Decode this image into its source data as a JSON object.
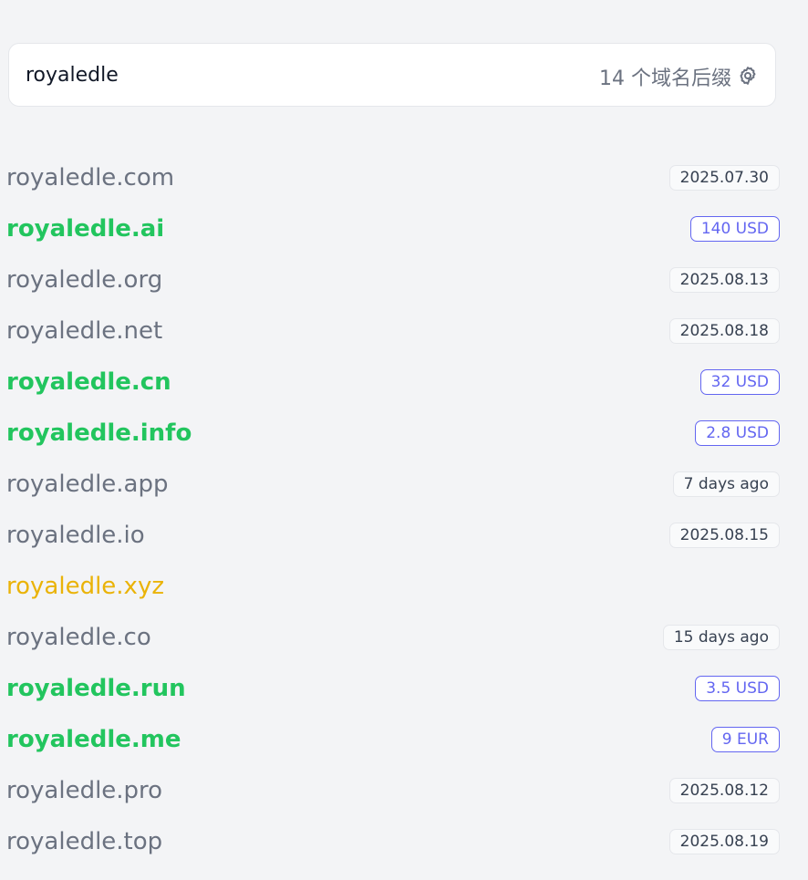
{
  "search": {
    "value": "royaledle",
    "suffix_count": "14 个域名后缀"
  },
  "domains": [
    {
      "name": "royaledle.com",
      "status": "taken",
      "badge": "2025.07.30",
      "badge_type": "date"
    },
    {
      "name": "royaledle.ai",
      "status": "available",
      "badge": "140 USD",
      "badge_type": "price"
    },
    {
      "name": "royaledle.org",
      "status": "taken",
      "badge": "2025.08.13",
      "badge_type": "date"
    },
    {
      "name": "royaledle.net",
      "status": "taken",
      "badge": "2025.08.18",
      "badge_type": "date"
    },
    {
      "name": "royaledle.cn",
      "status": "available",
      "badge": "32 USD",
      "badge_type": "price"
    },
    {
      "name": "royaledle.info",
      "status": "available",
      "badge": "2.8 USD",
      "badge_type": "price"
    },
    {
      "name": "royaledle.app",
      "status": "taken",
      "badge": "7 days ago",
      "badge_type": "date"
    },
    {
      "name": "royaledle.io",
      "status": "taken",
      "badge": "2025.08.15",
      "badge_type": "date"
    },
    {
      "name": "royaledle.xyz",
      "status": "pending",
      "badge": "",
      "badge_type": "none"
    },
    {
      "name": "royaledle.co",
      "status": "taken",
      "badge": "15 days ago",
      "badge_type": "date"
    },
    {
      "name": "royaledle.run",
      "status": "available",
      "badge": "3.5 USD",
      "badge_type": "price"
    },
    {
      "name": "royaledle.me",
      "status": "available",
      "badge": "9 EUR",
      "badge_type": "price"
    },
    {
      "name": "royaledle.pro",
      "status": "taken",
      "badge": "2025.08.12",
      "badge_type": "date"
    },
    {
      "name": "royaledle.top",
      "status": "taken",
      "badge": "2025.08.19",
      "badge_type": "date"
    }
  ],
  "colors": {
    "taken": "#6b7280",
    "available": "#22c55e",
    "pending": "#eab308",
    "price_accent": "#6366f1",
    "background": "#f3f4f6"
  },
  "icons": {
    "settings": "gear-icon"
  }
}
